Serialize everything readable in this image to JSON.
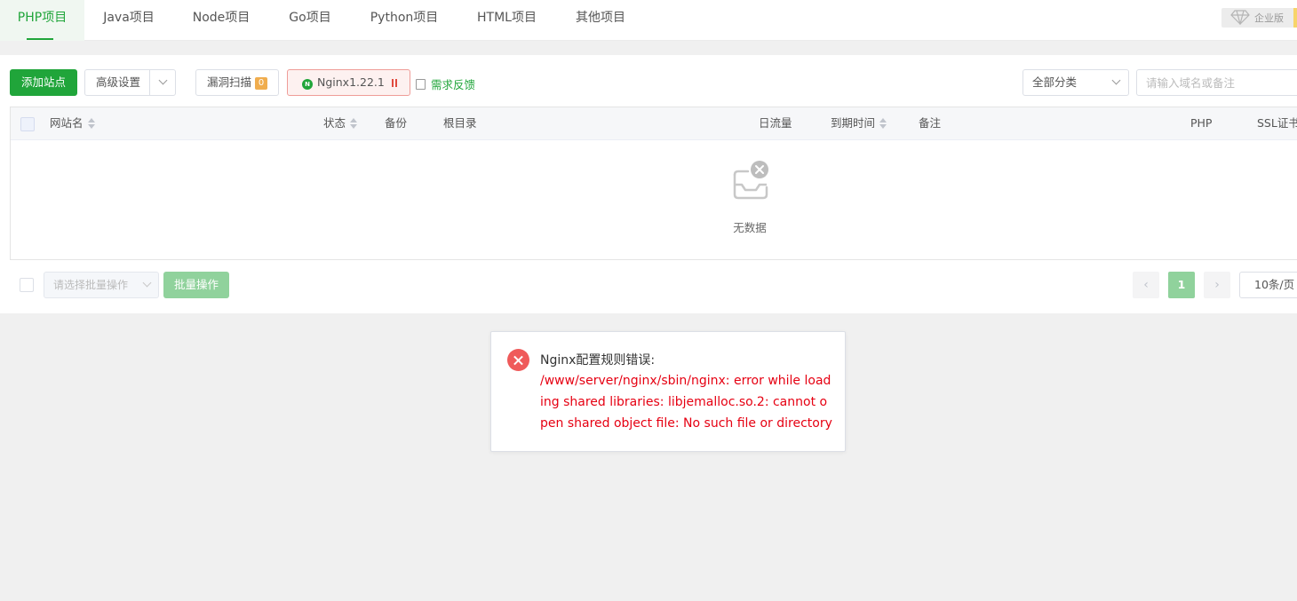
{
  "tabs": [
    {
      "label": "PHP项目",
      "active": true
    },
    {
      "label": "Java项目",
      "active": false
    },
    {
      "label": "Node项目",
      "active": false
    },
    {
      "label": "Go项目",
      "active": false
    },
    {
      "label": "Python项目",
      "active": false
    },
    {
      "label": "HTML项目",
      "active": false
    },
    {
      "label": "其他项目",
      "active": false
    }
  ],
  "enterprise_badge": {
    "label": "企业版",
    "icon": "diamond-icon"
  },
  "toolbar": {
    "add_site_label": "添加站点",
    "advanced_label": "高级设置",
    "vuln_scan_label": "漏洞扫描",
    "vuln_scan_count": "0",
    "nginx_label": "Nginx1.22.1",
    "nginx_icon_letter": "N",
    "feedback_label": "需求反馈",
    "category_label": "全部分类",
    "search_placeholder": "请输入域名或备注"
  },
  "table": {
    "headers": {
      "site_name": "网站名",
      "status": "状态",
      "backup": "备份",
      "root_dir": "根目录",
      "daily_traffic": "日流量",
      "expire_time": "到期时间",
      "remark": "备注",
      "php": "PHP",
      "ssl": "SSL证书"
    },
    "rows": [],
    "empty_text": "无数据"
  },
  "footer": {
    "batch_select_placeholder": "请选择批量操作",
    "batch_button_label": "批量操作",
    "pagination": {
      "prev": "‹",
      "current": "1",
      "next": "›"
    },
    "per_page": "10条/页"
  },
  "error_message": {
    "title": "Nginx配置规则错误:",
    "body": "/www/server/nginx/sbin/nginx: error while loading shared libraries: libjemalloc.so.2: cannot open shared object file: No such file or directory"
  },
  "colors": {
    "accent": "#20a53a",
    "error": "#e60012",
    "error_icon": "#ef5a5a",
    "badge": "#f0ad4e"
  }
}
